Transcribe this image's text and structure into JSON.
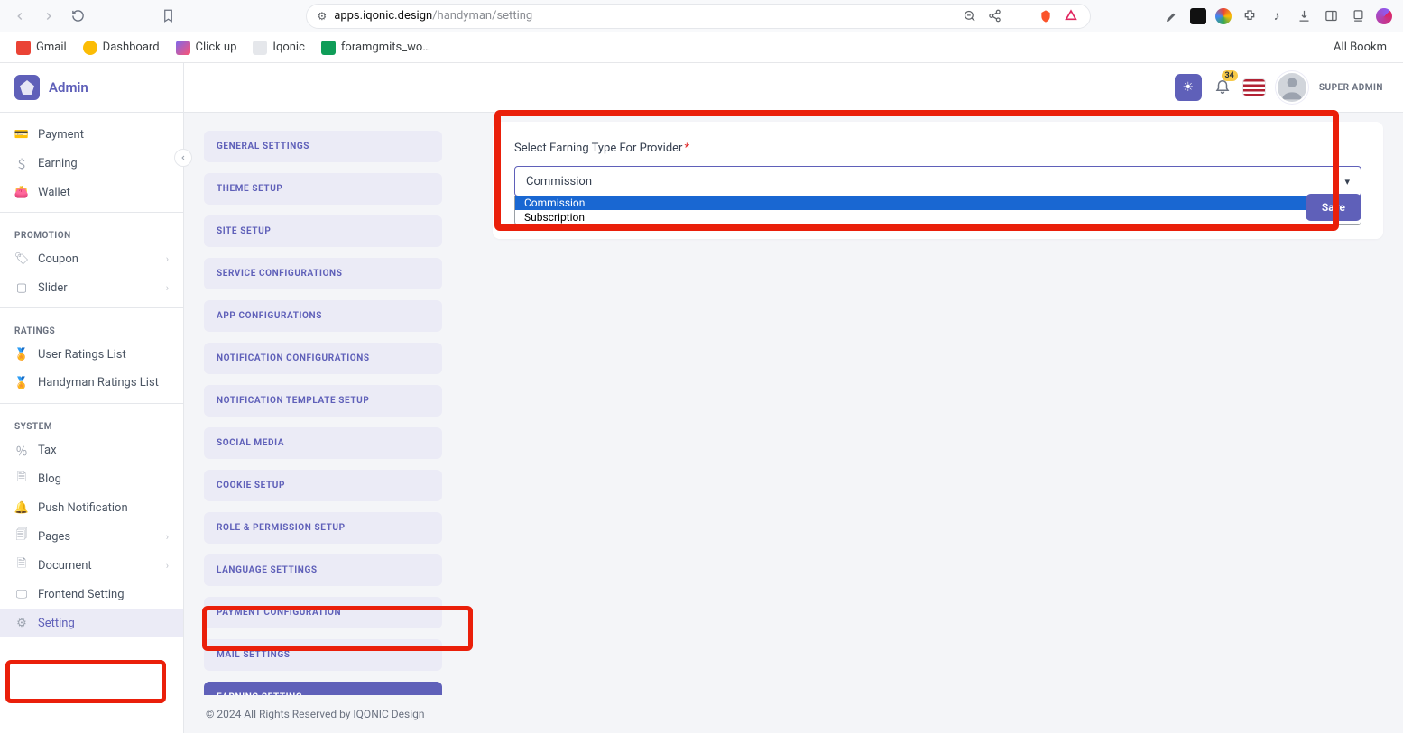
{
  "browser": {
    "url_host": "apps.iqonic.design",
    "url_path": "/handyman/setting"
  },
  "bookmarks": {
    "gmail": "Gmail",
    "dashboard": "Dashboard",
    "clickup": "Click up",
    "iqonic": "Iqonic",
    "foram": "foramgmits_wo…",
    "all": "All Bookm"
  },
  "brand": "Admin",
  "topbar": {
    "notification_count": "34",
    "user_role": "SUPER ADMIN"
  },
  "sidebar": {
    "items": {
      "payment": "Payment",
      "earning": "Earning",
      "wallet": "Wallet",
      "coupon": "Coupon",
      "slider": "Slider",
      "user_ratings": "User Ratings List",
      "handyman_ratings": "Handyman Ratings List",
      "tax": "Tax",
      "blog": "Blog",
      "push": "Push Notification",
      "pages": "Pages",
      "document": "Document",
      "frontend": "Frontend Setting",
      "setting": "Setting"
    },
    "sections": {
      "promotion": "PROMOTION",
      "ratings": "RATINGS",
      "system": "SYSTEM"
    }
  },
  "tabs": {
    "general": "GENERAL SETTINGS",
    "theme": "THEME SETUP",
    "site": "SITE SETUP",
    "service": "SERVICE CONFIGURATIONS",
    "app": "APP CONFIGURATIONS",
    "notif_conf": "NOTIFICATION CONFIGURATIONS",
    "notif_tpl": "NOTIFICATION TEMPLATE SETUP",
    "social": "SOCIAL MEDIA",
    "cookie": "COOKIE SETUP",
    "role": "ROLE & PERMISSION SETUP",
    "language": "LANGUAGE SETTINGS",
    "payment": "PAYMENT CONFIGURATION",
    "mail": "MAIL SETTINGS",
    "earning": "EARNING SETTING"
  },
  "panel": {
    "label": "Select Earning Type For Provider",
    "selected": "Commission",
    "options": {
      "commission": "Commission",
      "subscription": "Subscription"
    },
    "save": "Save"
  },
  "footer": "© 2024 All Rights Reserved by IQONIC Design"
}
